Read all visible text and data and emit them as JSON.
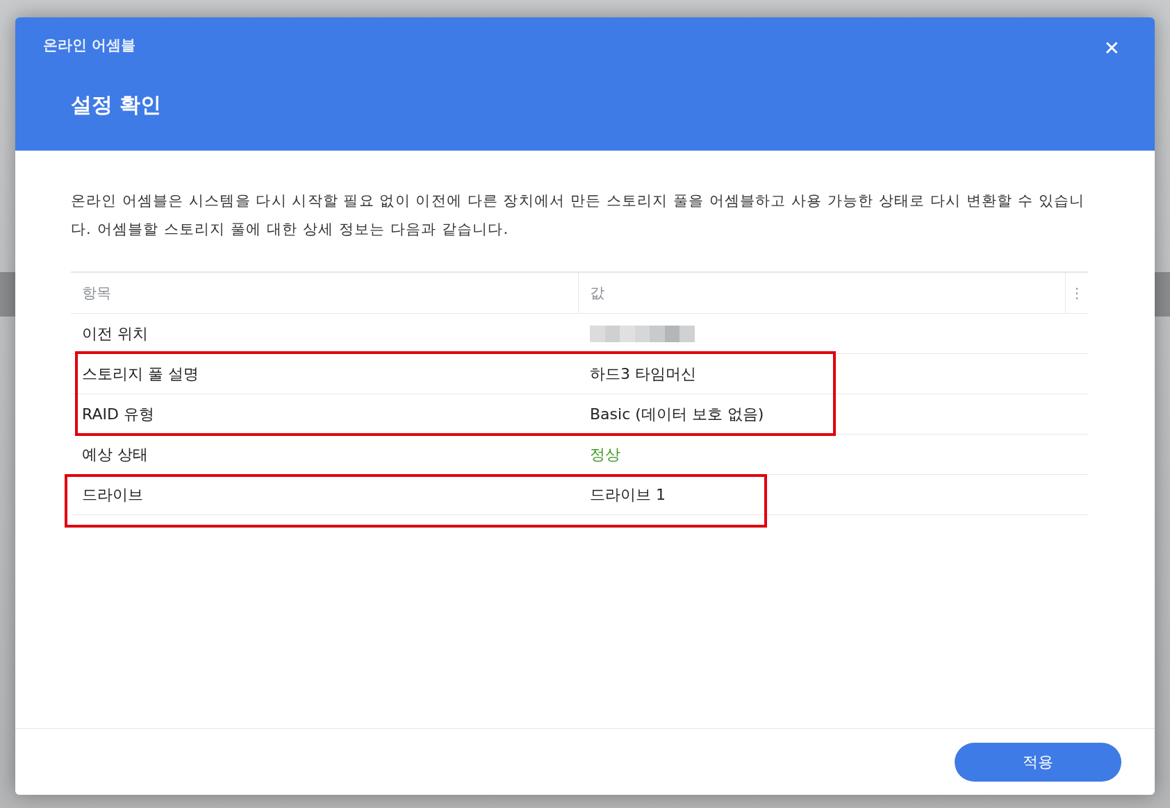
{
  "dialog": {
    "app_title": "온라인 어셈블",
    "heading": "설정 확인",
    "close_label": "✕"
  },
  "description": "온라인 어셈블은 시스템을 다시 시작할 필요 없이 이전에 다른 장치에서 만든 스토리지 풀을 어셈블하고 사용 가능한 상태로 다시 변환할 수 있습니다. 어셈블할 스토리지 풀에 대한 상세 정보는 다음과 같습니다.",
  "table": {
    "columns": [
      "항목",
      "값"
    ],
    "menu_label": "⋮",
    "rows": [
      {
        "item": "이전 위치",
        "kind": "redacted",
        "highlighted": false
      },
      {
        "item": "스토리지 풀 설명",
        "kind": "text",
        "value": "하드3 타임머신",
        "highlighted": true
      },
      {
        "item": "RAID 유형",
        "kind": "text",
        "value": "Basic (데이터 보호 없음)",
        "highlighted": true
      },
      {
        "item": "예상 상태",
        "kind": "status",
        "value": "정상",
        "color": "#3f9a1f",
        "highlighted": false
      },
      {
        "item": "드라이브",
        "kind": "text",
        "value": "드라이브 1",
        "highlighted": true
      }
    ]
  },
  "buttons": [
    {
      "label": "적용",
      "kind": "primary"
    }
  ]
}
